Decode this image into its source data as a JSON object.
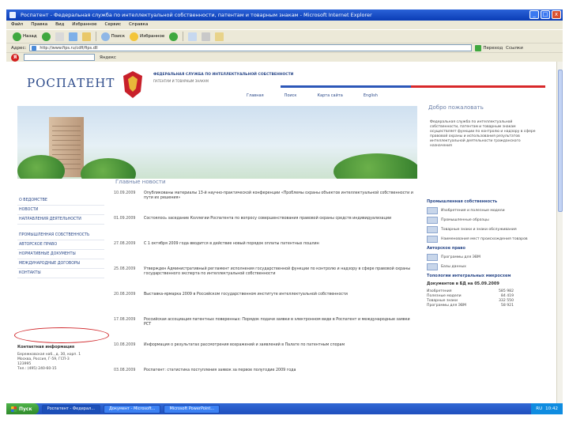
{
  "window": {
    "title": "Роспатент - Федеральная служба по интеллектуальной собственности, патентам и товарным знакам - Microsoft Internet Explorer",
    "controls": [
      "_",
      "□",
      "x"
    ]
  },
  "menu": [
    "Файл",
    "Правка",
    "Вид",
    "Избранное",
    "Сервис",
    "Справка"
  ],
  "toolbar": {
    "back": "Назад",
    "search": "Поиск",
    "favorites": "Избранное"
  },
  "address": {
    "label": "Адрес:",
    "url": "http://www.fips.ru/cdfi/fips.dll",
    "go": "Переход",
    "links": "Ссылки"
  },
  "linksbar": {
    "logo": "Я",
    "label": "Яндекс"
  },
  "site": {
    "logo": "РОСПАТЕНТ",
    "agency": "ФЕДЕРАЛЬНАЯ СЛУЖБА ПО ИНТЕЛЛЕКТУАЛЬНОЙ СОБСТВЕННОСТИ",
    "agency_sub": "ПАТЕНТАМ И ТОВАРНЫМ ЗНАКАМ",
    "top_nav": [
      "Главная",
      "Поиск",
      "Карта сайта",
      "English"
    ],
    "welcome_title": "Добро пожаловать",
    "welcome_text": "Федеральная служба по интеллектуальной собственности, патентам и товарным знакам осуществляет функции по контролю и надзору в сфере правовой охраны и использования результатов интеллектуальной деятельности гражданского назначения"
  },
  "left_nav": [
    "О ВЕДОМСТВЕ",
    "НОВОСТИ",
    "НАПРАВЛЕНИЯ ДЕЯТЕЛЬНОСТИ",
    "ПРОМЫШЛЕННАЯ СОБСТВЕННОСТЬ",
    "АВТОРСКОЕ ПРАВО",
    "НОРМАТИВНЫЕ ДОКУМЕНТЫ",
    "МЕЖДУНАРОДНЫЕ ДОГОВОРЫ",
    "КОНТАКТЫ"
  ],
  "contact": {
    "title": "Контактная информация",
    "lines": [
      "Бережковская наб., д. 30, корп. 1",
      "Москва, Россия, Г-59, ГСП-3",
      "123995",
      "Тел.: (495) 240-60-15"
    ]
  },
  "news": {
    "heading": "Главные новости",
    "items": [
      {
        "date": "10.09.2009",
        "text": "Опубликованы материалы 13-й научно-практической конференции «Проблемы охраны объектов интеллектуальной собственности и пути их решения»",
        "link": "материалы"
      },
      {
        "date": "01.09.2009",
        "text": "Состоялось заседание Коллегии Роспатента по вопросу совершенствования правовой охраны средств индивидуализации",
        "link": "Коллегии"
      },
      {
        "date": "27.08.2009",
        "text": "С 1 октября 2009 года вводится в действие новый порядок оплаты патентных пошлин",
        "link": "порядок"
      },
      {
        "date": "25.08.2009",
        "text": "Утвержден Административный регламент исполнения государственной функции по контролю и надзору в сфере правовой охраны государственного эксперта по интеллектуальной собственности",
        "link": "Административный регламент"
      },
      {
        "date": "20.08.2009",
        "text": "Выставка-ярмарка 2009 в Российском государственном институте интеллектуальной собственности",
        "link": "Выставка"
      },
      {
        "date": "17.08.2009",
        "text": "Российская ассоциация патентных поверенных: Порядок подачи заявки в электронном виде в Роспатент и международные заявки РСТ",
        "link": "Порядок подачи заявки"
      },
      {
        "date": "10.08.2009",
        "text": "Информация о результатах рассмотрения возражений и заявлений в Палате по патентным спорам",
        "link": "Палате по патентным спорам"
      },
      {
        "date": "03.08.2009",
        "text": "Роспатент: статистика поступления заявок за первое полугодие 2009 года",
        "link": "статистика"
      }
    ]
  },
  "right": {
    "ip_head": "Промышленная собственность",
    "ip_items": [
      "Изобретения и полезные модели",
      "Промышленные образцы",
      "Товарные знаки и знаки обслуживания",
      "Наименования мест происхождения товаров"
    ],
    "copy_head": "Авторское право",
    "copy_items": [
      "Программы для ЭВМ",
      "Базы данных"
    ],
    "tech_head": "Топологии интегральных микросхем",
    "stats_head": "Документов в БД на 05.09.2009",
    "stats": [
      {
        "label": "Изобретения",
        "value": "585 982"
      },
      {
        "label": "Полезные модели",
        "value": "84 419"
      },
      {
        "label": "Товарные знаки",
        "value": "332 550"
      },
      {
        "label": "Программы для ЭВМ",
        "value": "58 921"
      }
    ]
  },
  "taskbar": {
    "start": "Пуск",
    "tasks": [
      "Роспатент - Федерал...",
      "Документ - Microsoft...",
      "Microsoft PowerPoint..."
    ],
    "clock": "10:42",
    "lang": "RU"
  }
}
